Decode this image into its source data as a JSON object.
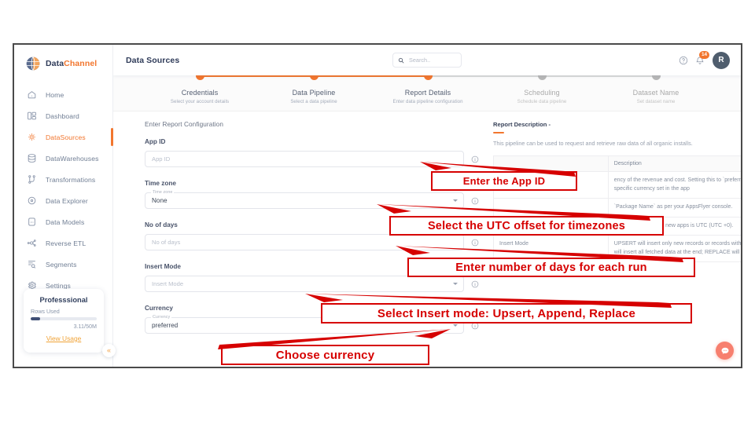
{
  "sidebar": {
    "brand": {
      "part1": "Data",
      "part2": "Channel",
      "logo_icon": "globe-logo-icon"
    },
    "items": [
      {
        "label": "Home",
        "icon": "home-icon",
        "active": false
      },
      {
        "label": "Dashboard",
        "icon": "dashboard-icon",
        "active": false
      },
      {
        "label": "DataSources",
        "icon": "datasources-icon",
        "active": true
      },
      {
        "label": "DataWarehouses",
        "icon": "database-icon",
        "active": false
      },
      {
        "label": "Transformations",
        "icon": "transformations-icon",
        "active": false
      },
      {
        "label": "Data Explorer",
        "icon": "data-explorer-icon",
        "active": false
      },
      {
        "label": "Data Models",
        "icon": "data-models-icon",
        "active": false
      },
      {
        "label": "Reverse ETL",
        "icon": "reverse-etl-icon",
        "active": false
      },
      {
        "label": "Segments",
        "icon": "segments-icon",
        "active": false
      },
      {
        "label": "Settings",
        "icon": "gear-icon",
        "active": false
      }
    ],
    "plan": {
      "name": "Professsional",
      "rows_label": "Rows Used",
      "quota": "3.11/50M",
      "usage_percent": 14,
      "view_usage_label": "View Usage"
    },
    "collapse_label": "«"
  },
  "topbar": {
    "title": "Data Sources",
    "search_placeholder": "Search..",
    "search_value": "",
    "notification_count": "14",
    "avatar_initial": "R"
  },
  "stepper": [
    {
      "title": "Credentials",
      "subtitle": "Select your account details",
      "state": "done"
    },
    {
      "title": "Data Pipeline",
      "subtitle": "Select a data pipeline",
      "state": "done"
    },
    {
      "title": "Report Details",
      "subtitle": "Enter data pipeline configuration",
      "state": "done"
    },
    {
      "title": "Scheduling",
      "subtitle": "Schedule data pipeline",
      "state": "todo"
    },
    {
      "title": "Dataset Name",
      "subtitle": "Set dataset name",
      "state": "todo"
    }
  ],
  "form": {
    "section_title": "Enter Report Configuration",
    "fields": [
      {
        "label": "App ID",
        "placeholder": "App ID",
        "value": "",
        "float_label": "",
        "type": "text"
      },
      {
        "label": "Time zone",
        "placeholder": "",
        "value": "None",
        "float_label": "Time zone",
        "type": "select"
      },
      {
        "label": "No of days",
        "placeholder": "No of days",
        "value": "",
        "float_label": "",
        "type": "text"
      },
      {
        "label": "Insert Mode",
        "placeholder": "Insert Mode",
        "value": "",
        "float_label": "",
        "type": "select"
      },
      {
        "label": "Currency",
        "placeholder": "",
        "value": "preferred",
        "float_label": "Currency",
        "type": "select"
      }
    ]
  },
  "description": {
    "title": "Report Description -",
    "text": "This pipeline can be used to request and retrieve raw data of all organic installs.",
    "table": {
      "headers": [
        "",
        "Description"
      ],
      "rows": [
        {
          "name": "",
          "description": "ency of the revenue and cost. Setting this to `preferred` returns the app-specific currency set in the app"
        },
        {
          "name": "",
          "description": "`Package Name` as per your AppsFlyer console."
        },
        {
          "name": "",
          "description": "default time zone for new apps is UTC (UTC +0)."
        },
        {
          "name": "Insert Mode",
          "description": "UPSERT will insert only new records or records with changes; APPEND will insert all fetched data at the end; REPLACE will drop the existing table"
        }
      ]
    }
  },
  "chat": {
    "icon": "chat-bubble-icon"
  },
  "annotations": [
    {
      "text": "Enter the App ID"
    },
    {
      "text": "Select the UTC offset for timezones"
    },
    {
      "text": "Enter number of days for each run"
    },
    {
      "text": "Select Insert mode: Upsert, Append, Replace"
    },
    {
      "text": "Choose currency"
    }
  ],
  "colors": {
    "accent": "#f2762e",
    "brand_dark": "#2f3b59",
    "annotation_red": "#d60000",
    "chat_fab": "#f77f6e"
  }
}
